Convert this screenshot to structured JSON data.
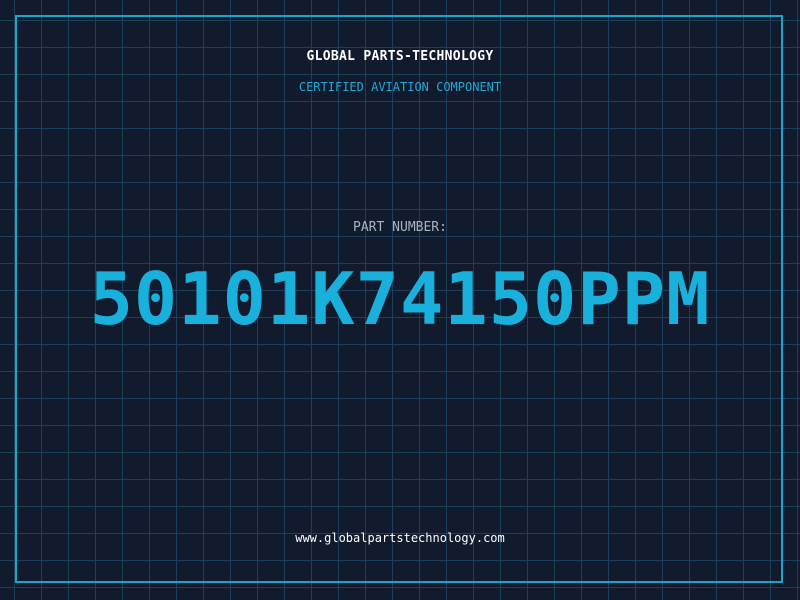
{
  "header": {
    "company_name": "GLOBAL PARTS-TECHNOLOGY",
    "subtitle": "CERTIFIED AVIATION COMPONENT"
  },
  "part": {
    "label": "PART NUMBER:",
    "number": "50101K74150PPM"
  },
  "footer": {
    "website": "www.globalpartstechnology.com"
  },
  "colors": {
    "background": "#121a2e",
    "grid": "#1d3f5a",
    "accent": "#19b1dc",
    "frame": "#1aa6c8"
  }
}
